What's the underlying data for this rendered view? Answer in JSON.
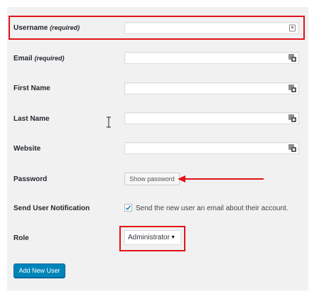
{
  "form": {
    "username": {
      "label": "Username",
      "required": "(required)",
      "value": ""
    },
    "email": {
      "label": "Email",
      "required": "(required)",
      "value": ""
    },
    "first_name": {
      "label": "First Name",
      "value": ""
    },
    "last_name": {
      "label": "Last Name",
      "value": ""
    },
    "website": {
      "label": "Website",
      "value": ""
    },
    "password": {
      "label": "Password",
      "button": "Show password"
    },
    "notification": {
      "label": "Send User Notification",
      "checkbox_label": "Send the new user an email about their account.",
      "checked": true
    },
    "role": {
      "label": "Role",
      "selected": "Administrator"
    },
    "submit": "Add New User"
  },
  "colors": {
    "highlight": "#e1131a",
    "primary_button": "#0085ba",
    "panel_background": "#f1f1f1"
  },
  "icons": [
    "password-manager-icon",
    "checkmark-icon",
    "dropdown-arrow-icon",
    "text-cursor-icon",
    "annotation-arrow"
  ]
}
